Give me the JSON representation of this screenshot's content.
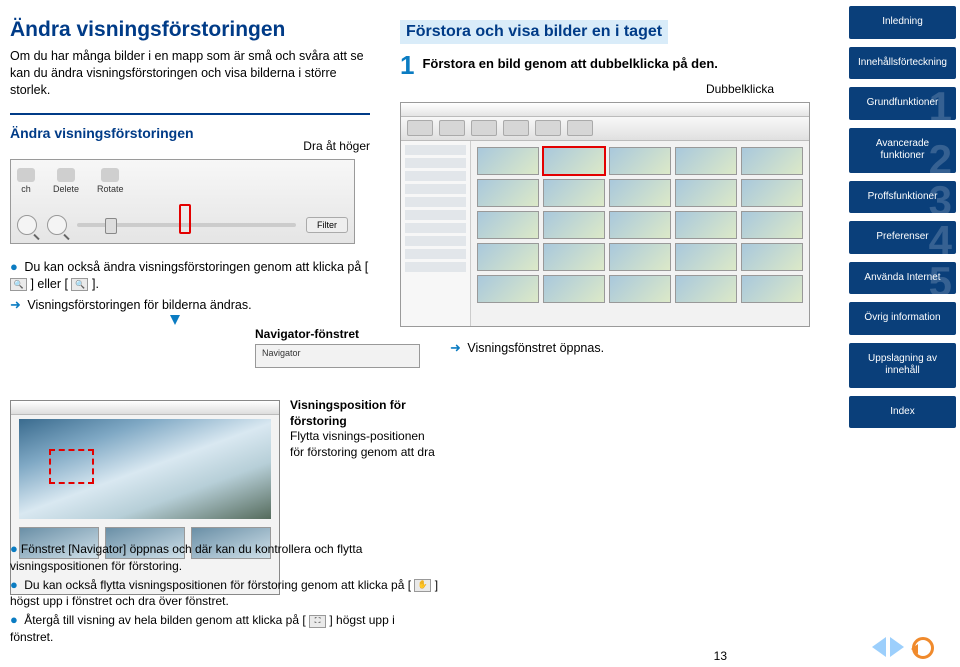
{
  "left": {
    "title": "Ändra visningsförstoringen",
    "lead": "Om du har många bilder i en mapp som är små och svåra att se kan du ändra visningsförstoringen och visa bilderna i större storlek.",
    "subheading": "Ändra visningsförstoringen",
    "drag_label": "Dra åt höger",
    "toolbar": {
      "items": [
        "ch",
        "Delete",
        "Rotate"
      ],
      "filter": "Filter"
    },
    "note1_part1": "Du kan också ändra visningsförstoringen genom att klicka på [",
    "note1_part2": "] eller [",
    "note1_part3": "].",
    "note2": "Visningsförstoringen för bilderna ändras."
  },
  "right": {
    "hl_title": "Förstora och visa bilder en i taget",
    "step_num": "1",
    "step_text": "Förstora en bild genom att dubbelklicka på den.",
    "caption": "Dubbelklicka",
    "open_note": "Visningsfönstret öppnas."
  },
  "nav_window": {
    "label": "Navigator-fönstret",
    "inner": "Navigator"
  },
  "info": {
    "heading": "Visningsposition för förstoring",
    "body": "Flytta visnings-positionen för förstoring genom att dra"
  },
  "bottom": {
    "b1": "Fönstret [Navigator] öppnas och där kan du kontrollera och flytta visningspositionen för förstoring.",
    "b2_a": "Du kan också flytta visningspositionen för förstoring genom att klicka på [",
    "b2_b": "] högst upp i fönstret och dra över fönstret.",
    "b3_a": "Återgå till visning av hela bilden genom att klicka på [",
    "b3_b": "] högst upp i fönstret."
  },
  "sidebar": {
    "items": [
      {
        "label": "Inledning",
        "num": ""
      },
      {
        "label": "Innehållsförteckning",
        "num": ""
      },
      {
        "label": "Grundfunktioner",
        "num": "1"
      },
      {
        "label": "Avancerade funktioner",
        "num": "2"
      },
      {
        "label": "Proffsfunktioner",
        "num": "3"
      },
      {
        "label": "Preferenser",
        "num": "4"
      },
      {
        "label": "Använda Internet",
        "num": "5"
      },
      {
        "label": "Övrig information",
        "num": ""
      },
      {
        "label": "Uppslagning av innehåll",
        "num": ""
      },
      {
        "label": "Index",
        "num": ""
      }
    ]
  },
  "page_number": "13"
}
